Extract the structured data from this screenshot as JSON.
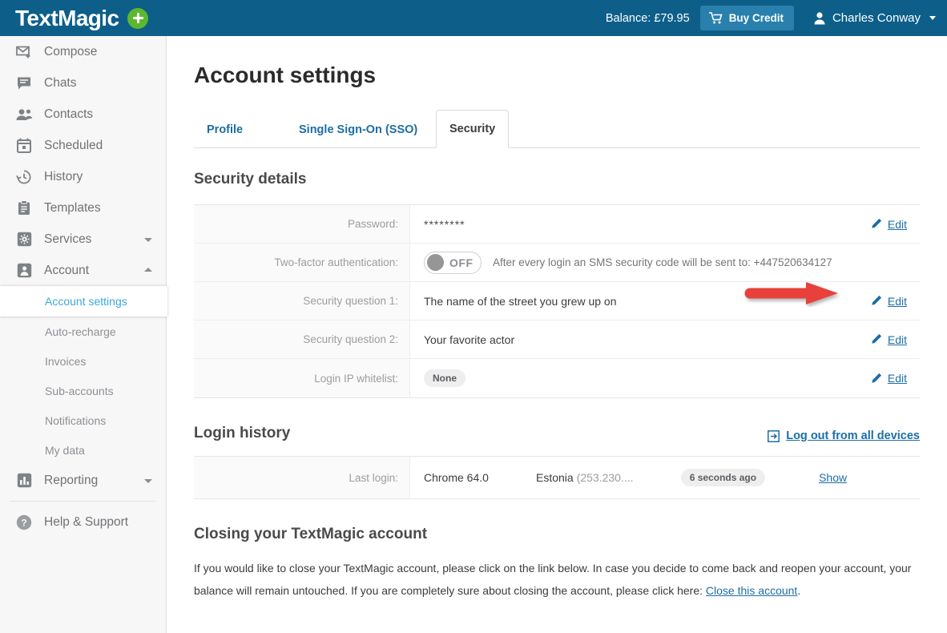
{
  "topbar": {
    "logo_text": "TextMagic",
    "logo_wifi_icon": "wifi-icon",
    "add_badge_icon": "plus-icon",
    "balance_label": "Balance: £79.95",
    "buy_credit_label": "Buy Credit",
    "cart_icon": "shopping-cart-icon",
    "user_name": "Charles Conway",
    "user_icon": "person-icon",
    "caret_icon": "chevron-down-icon",
    "accent_color": "#0d5f8a",
    "button_color": "#2980ac",
    "badge_color": "#5cb82e"
  },
  "sidebar": {
    "items": [
      {
        "label": "Compose",
        "icon": "compose-mail-icon"
      },
      {
        "label": "Chats",
        "icon": "chat-bubble-icon"
      },
      {
        "label": "Contacts",
        "icon": "contacts-people-icon"
      },
      {
        "label": "Scheduled",
        "icon": "calendar-icon"
      },
      {
        "label": "History",
        "icon": "clock-history-icon"
      },
      {
        "label": "Templates",
        "icon": "clipboard-icon"
      },
      {
        "label": "Services",
        "icon": "gear-icon",
        "caret": "chevron-down-icon"
      },
      {
        "label": "Account",
        "icon": "account-card-icon",
        "caret": "chevron-up-icon"
      }
    ],
    "account_subitems": [
      {
        "label": "Account settings",
        "active": true
      },
      {
        "label": "Auto-recharge",
        "active": false
      },
      {
        "label": "Invoices",
        "active": false
      },
      {
        "label": "Sub-accounts",
        "active": false
      },
      {
        "label": "Notifications",
        "active": false
      },
      {
        "label": "My data",
        "active": false
      }
    ],
    "reporting": {
      "label": "Reporting",
      "icon": "bar-chart-icon",
      "caret": "chevron-down-icon"
    },
    "help": {
      "label": "Help & Support",
      "icon": "question-circle-icon"
    }
  },
  "main": {
    "page_title": "Account settings",
    "tabs": [
      {
        "label": "Profile",
        "active": false
      },
      {
        "label": "Single Sign-On (SSO)",
        "active": false
      },
      {
        "label": "Security",
        "active": true
      }
    ],
    "security_details": {
      "heading": "Security details",
      "rows": [
        {
          "label": "Password:",
          "value": "********",
          "type": "password",
          "action": "Edit",
          "action_icon": "pencil-icon"
        },
        {
          "label": "Two-factor authentication:",
          "type": "toggle",
          "toggle_state": "OFF",
          "note": "After every login an SMS security code will be sent to: +447520634127",
          "action": "",
          "action_icon": ""
        },
        {
          "label": "Security question 1:",
          "value": "The name of the street you grew up on",
          "type": "text",
          "action": "Edit",
          "action_icon": "pencil-icon",
          "annotated": true
        },
        {
          "label": "Security question 2:",
          "value": "Your favorite actor",
          "type": "text",
          "action": "Edit",
          "action_icon": "pencil-icon"
        },
        {
          "label": "Login IP whitelist:",
          "value": "None",
          "type": "pill",
          "action": "Edit",
          "action_icon": "pencil-icon"
        }
      ]
    },
    "login_history": {
      "heading": "Login history",
      "logout_all_label": "Log out from all devices",
      "logout_all_icon": "logout-icon",
      "row": {
        "label": "Last login:",
        "browser": "Chrome 64.0",
        "location": "Estonia",
        "ip": "(253.230....",
        "time_ago": "6 seconds ago",
        "show_label": "Show"
      }
    },
    "closing": {
      "heading": "Closing your TextMagic account",
      "text_before": "If you would like to close your TextMagic account, please click on the link below. In case you decide to come back and reopen your account, your balance will remain untouched. If you are completely sure about closing the account, please click here: ",
      "link_label": "Close this account",
      "text_after": "."
    }
  },
  "annotation": {
    "arrow_icon": "red-arrow-right",
    "arrow_color": "#e8403a",
    "points_at": "Security question 1 Edit link"
  }
}
